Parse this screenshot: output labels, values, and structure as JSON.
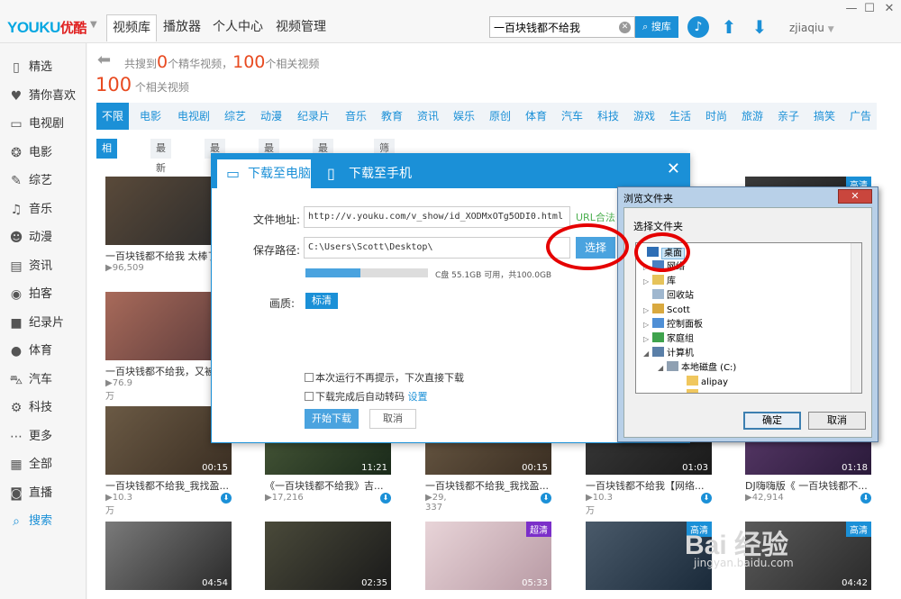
{
  "app": {
    "logo_latin": "YOUKU",
    "logo_cn": "优酷",
    "nav_tabs": [
      "视频库",
      "播放器",
      "个人中心",
      "视频管理"
    ],
    "search_value": "一百块钱都不给我",
    "search_button": "搜库",
    "username": "zjiaqiu"
  },
  "sidebar": {
    "items": [
      {
        "label": "精选",
        "icon": "phone-icon"
      },
      {
        "label": "猜你喜欢",
        "icon": "heart-icon"
      },
      {
        "label": "电视剧",
        "icon": "tv-icon"
      },
      {
        "label": "电影",
        "icon": "film-reel-icon"
      },
      {
        "label": "综艺",
        "icon": "microphone-icon"
      },
      {
        "label": "音乐",
        "icon": "music-note-icon"
      },
      {
        "label": "动漫",
        "icon": "bear-face-icon"
      },
      {
        "label": "资讯",
        "icon": "news-icon"
      },
      {
        "label": "拍客",
        "icon": "camera-icon"
      },
      {
        "label": "纪录片",
        "icon": "video-camera-icon"
      },
      {
        "label": "体育",
        "icon": "ball-icon"
      },
      {
        "label": "汽车",
        "icon": "car-icon"
      },
      {
        "label": "科技",
        "icon": "gear-icon"
      },
      {
        "label": "更多",
        "icon": "more-dots-icon"
      },
      {
        "label": "全部",
        "icon": "grid-icon"
      },
      {
        "label": "直播",
        "icon": "live-camera-icon"
      },
      {
        "label": "搜索",
        "icon": "search-icon"
      }
    ]
  },
  "results": {
    "summary_prefix": "共搜到",
    "featured_count": "0",
    "summary_mid": "个精华视频，",
    "related_count": "100",
    "summary_suffix": "个相关视频",
    "count_big": "100",
    "count_label": "个相关视频"
  },
  "categories": [
    "不限",
    "电影",
    "电视剧",
    "综艺",
    "动漫",
    "纪录片",
    "音乐",
    "教育",
    "资讯",
    "娱乐",
    "原创",
    "体育",
    "汽车",
    "科技",
    "游戏",
    "生活",
    "时尚",
    "旅游",
    "亲子",
    "搞笑",
    "广告"
  ],
  "sort_options": [
    "相关程度",
    "最新发布",
    "最多播放",
    "最多评论",
    "最多收藏",
    "筛选条件▼"
  ],
  "videos": [
    {
      "title": "一百块钱都不给我  太棒了",
      "plays": "96,509",
      "duration": "",
      "badge": ""
    },
    {
      "title": "一百块钱都不给我，又被",
      "plays": "76.9万",
      "duration": "",
      "badge": "高"
    },
    {
      "title": "一百块钱都不给我_我找盈...",
      "plays": "10.3万",
      "duration": "00:15",
      "badge": "超"
    },
    {
      "title": "《一百块钱都不给我》吉...",
      "plays": "17,216",
      "duration": "11:21",
      "badge": ""
    },
    {
      "title": "一百块钱都不给我_我找盈...",
      "plays": "29, 337",
      "duration": "00:15",
      "badge": ""
    },
    {
      "title": "一百块钱都不给我【网络...",
      "plays": "10.3万",
      "duration": "01:03",
      "badge": ""
    },
    {
      "title": "DJ嗨嗨版《 一百块钱都不...",
      "plays": "42,914",
      "duration": "01:18",
      "badge": ""
    },
    {
      "title": "",
      "plays": "",
      "duration": "04:54",
      "badge": ""
    },
    {
      "title": "",
      "plays": "",
      "duration": "02:35",
      "badge": ""
    },
    {
      "title": "",
      "plays": "",
      "duration": "05:33",
      "badge": "超清"
    },
    {
      "title": "",
      "plays": "",
      "duration": "",
      "badge": "高清"
    },
    {
      "title": "",
      "plays": "",
      "duration": "04:42",
      "badge": "高清"
    },
    {
      "title": "",
      "plays": "",
      "duration": "",
      "badge": "高清"
    },
    {
      "title": "",
      "plays": "",
      "duration": "",
      "badge": "高清"
    }
  ],
  "download_dialog": {
    "tab_pc": "下载至电脑",
    "tab_phone": "下载至手机",
    "url_label": "文件地址:",
    "url_value": "http://v.youku.com/v_show/id_XODMxOTg5ODI0.html",
    "url_valid": "URL合法",
    "save_label": "保存路径:",
    "save_value": "C:\\Users\\Scott\\Desktop\\",
    "choose_button": "选择",
    "disk_used_fraction": 0.45,
    "disk_text": "C盘  55.1GB 可用，共100.0GB",
    "quality_label": "画质:",
    "quality_value": "标清",
    "no_prompt": "本次运行不再提示，下次直接下载",
    "auto_convert": "下载完成后自动转码",
    "settings_link": "设置",
    "start_button": "开始下载",
    "cancel_button": "取消"
  },
  "browse_dialog": {
    "title": "浏览文件夹",
    "prompt": "选择文件夹",
    "tree": [
      {
        "label": "桌面",
        "level": 0,
        "toggle": "",
        "icon": "desktop-icon",
        "selected": true
      },
      {
        "label": "网络",
        "level": 1,
        "toggle": "▷",
        "icon": "network-icon"
      },
      {
        "label": "库",
        "level": 1,
        "toggle": "▷",
        "icon": "library-icon"
      },
      {
        "label": "回收站",
        "level": 1,
        "toggle": "",
        "icon": "recycle-bin-icon"
      },
      {
        "label": "Scott",
        "level": 1,
        "toggle": "▷",
        "icon": "user-folder-icon"
      },
      {
        "label": "控制面板",
        "level": 1,
        "toggle": "▷",
        "icon": "control-panel-icon"
      },
      {
        "label": "家庭组",
        "level": 1,
        "toggle": "▷",
        "icon": "homegroup-icon"
      },
      {
        "label": "计算机",
        "level": 1,
        "toggle": "◢",
        "icon": "computer-icon"
      },
      {
        "label": "本地磁盘 (C:)",
        "level": 2,
        "toggle": "◢",
        "icon": "disk-icon"
      },
      {
        "label": "alipay",
        "level": 3,
        "toggle": "",
        "icon": "folder-icon"
      },
      {
        "label": "...",
        "level": 3,
        "toggle": "",
        "icon": "folder-icon"
      }
    ],
    "ok_button": "确定",
    "cancel_button": "取消"
  },
  "watermark": {
    "text": "Bai 经验",
    "url": "jingyan.baidu.com"
  },
  "colors": {
    "accent": "#1b90d7",
    "count": "#e84a20",
    "annotation": "#e50000"
  }
}
